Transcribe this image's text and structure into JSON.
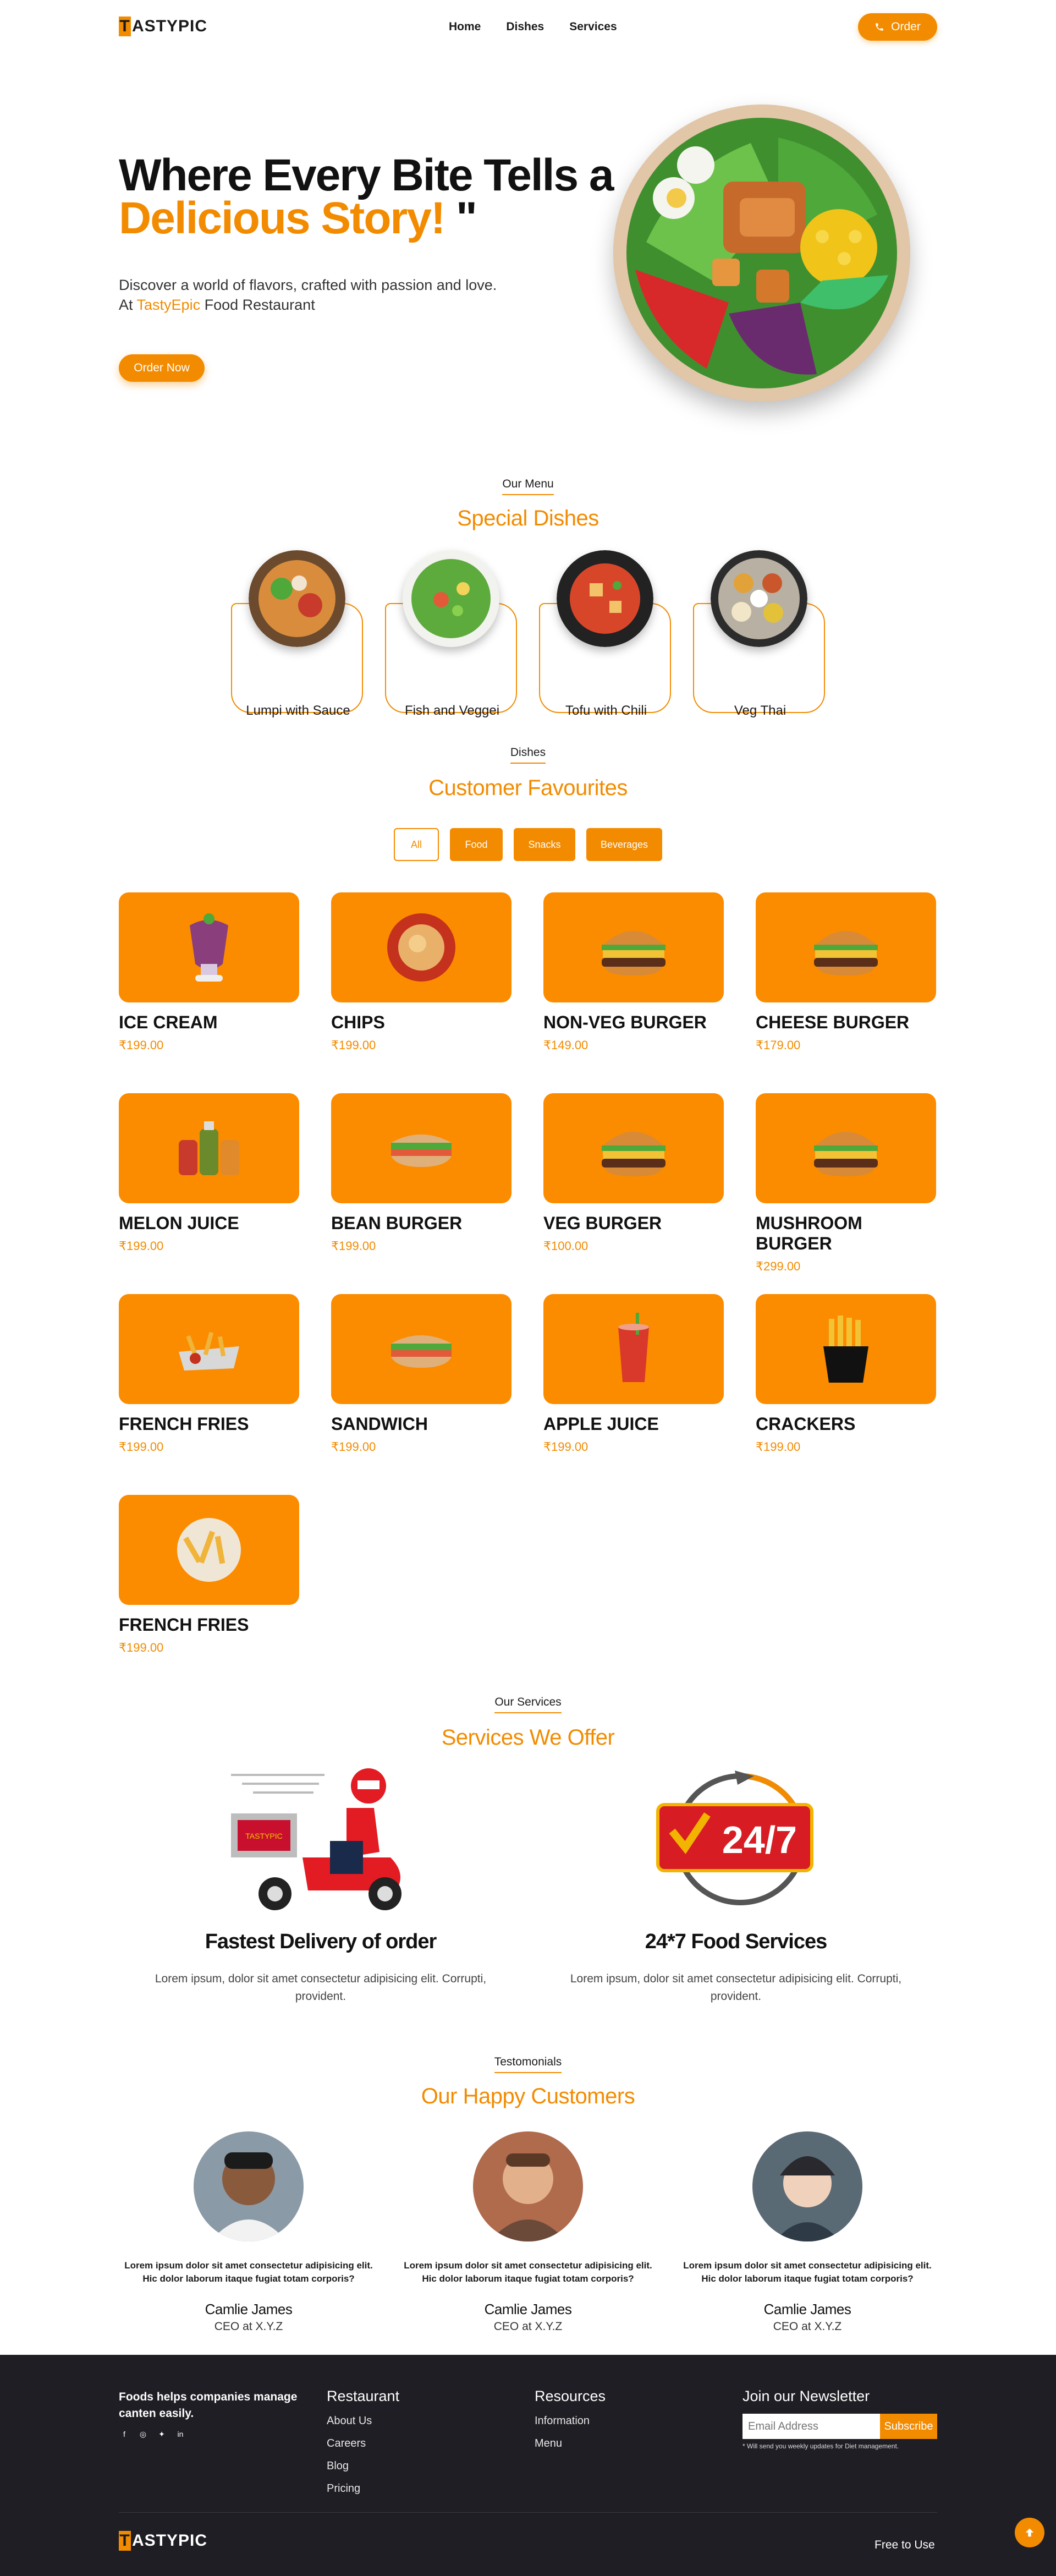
{
  "brand": {
    "logo_letter": "T",
    "logo_rest": "ASTYPIC",
    "accent": "#f28b00"
  },
  "nav": {
    "links": [
      "Home",
      "Dishes",
      "Services"
    ],
    "order_label": "Order"
  },
  "hero": {
    "title_line1": "Where Every Bite Tells a",
    "title_line2": "Delicious Story!",
    "title_quote": "\"",
    "desc_line1": "Discover a world of flavors, crafted with passion and love.",
    "desc_prefix": "At ",
    "desc_brand": "TastyEpic",
    "desc_suffix": " Food Restaurant",
    "button": "Order Now"
  },
  "menu": {
    "tag": "Our Menu",
    "title": "Special Dishes",
    "items": [
      "Lumpi with Sauce",
      "Fish and Veggei",
      "Tofu with Chili",
      "Veg Thai"
    ]
  },
  "dishes": {
    "tag": "Dishes",
    "title": "Customer Favourites",
    "filters": [
      "All",
      "Food",
      "Snacks",
      "Beverages"
    ],
    "products": [
      {
        "name": "ICE CREAM",
        "price": "₹199.00",
        "icon": "ice-cream-glass"
      },
      {
        "name": "CHIPS",
        "price": "₹199.00",
        "icon": "chips-bowl"
      },
      {
        "name": "NON-VEG BURGER",
        "price": "₹149.00",
        "icon": "burger"
      },
      {
        "name": "CHEESE BURGER",
        "price": "₹179.00",
        "icon": "burger"
      },
      {
        "name": "MELON JUICE",
        "price": "₹199.00",
        "icon": "juice-bottles"
      },
      {
        "name": "BEAN BURGER",
        "price": "₹199.00",
        "icon": "sandwich"
      },
      {
        "name": "VEG BURGER",
        "price": "₹100.00",
        "icon": "burger"
      },
      {
        "name": "MUSHROOM BURGER",
        "price": "₹299.00",
        "icon": "burger"
      },
      {
        "name": "FRENCH FRIES",
        "price": "₹199.00",
        "icon": "fries-tray"
      },
      {
        "name": "SANDWICH",
        "price": "₹199.00",
        "icon": "sandwich"
      },
      {
        "name": "APPLE JUICE",
        "price": "₹199.00",
        "icon": "juice-glass"
      },
      {
        "name": "CRACKERS",
        "price": "₹199.00",
        "icon": "fries-cup"
      },
      {
        "name": "FRENCH FRIES",
        "price": "₹199.00",
        "icon": "fries-bowl"
      }
    ]
  },
  "services": {
    "tag": "Our Services",
    "title": "Services We Offer",
    "items": [
      {
        "title": "Fastest Delivery of order",
        "desc": "Lorem ipsum, dolor sit amet consectetur adipisicing elit. Corrupti, provident."
      },
      {
        "title": "24*7 Food Services",
        "desc": "Lorem ipsum, dolor sit amet consectetur adipisicing elit. Corrupti, provident."
      }
    ],
    "scooter_sign": "TASTYPIC",
    "clock_text": "24/7"
  },
  "testimonials": {
    "tag": "Testomonials",
    "title": "Our Happy Customers",
    "items": [
      {
        "text": "Lorem ipsum dolor sit amet consectetur adipisicing elit. Hic dolor laborum itaque fugiat totam corporis?",
        "name": "Camlie James",
        "role": "CEO at X.Y.Z"
      },
      {
        "text": "Lorem ipsum dolor sit amet consectetur adipisicing elit. Hic dolor laborum itaque fugiat totam corporis?",
        "name": "Camlie James",
        "role": "CEO at X.Y.Z"
      },
      {
        "text": "Lorem ipsum dolor sit amet consectetur adipisicing elit. Hic dolor laborum itaque fugiat totam corporis?",
        "name": "Camlie James",
        "role": "CEO at X.Y.Z"
      }
    ]
  },
  "footer": {
    "about": "Foods helps companies manage canten easily.",
    "restaurant": {
      "title": "Restaurant",
      "links": [
        "About Us",
        "Careers",
        "Blog",
        "Pricing"
      ]
    },
    "resources": {
      "title": "Resources",
      "links": [
        "Information",
        "Menu"
      ]
    },
    "newsletter": {
      "title": "Join our Newsletter",
      "placeholder": "Email Address",
      "button": "Subscribe",
      "note": "* Will send you weekly updates for Diet management."
    },
    "free": "Free to Use"
  }
}
